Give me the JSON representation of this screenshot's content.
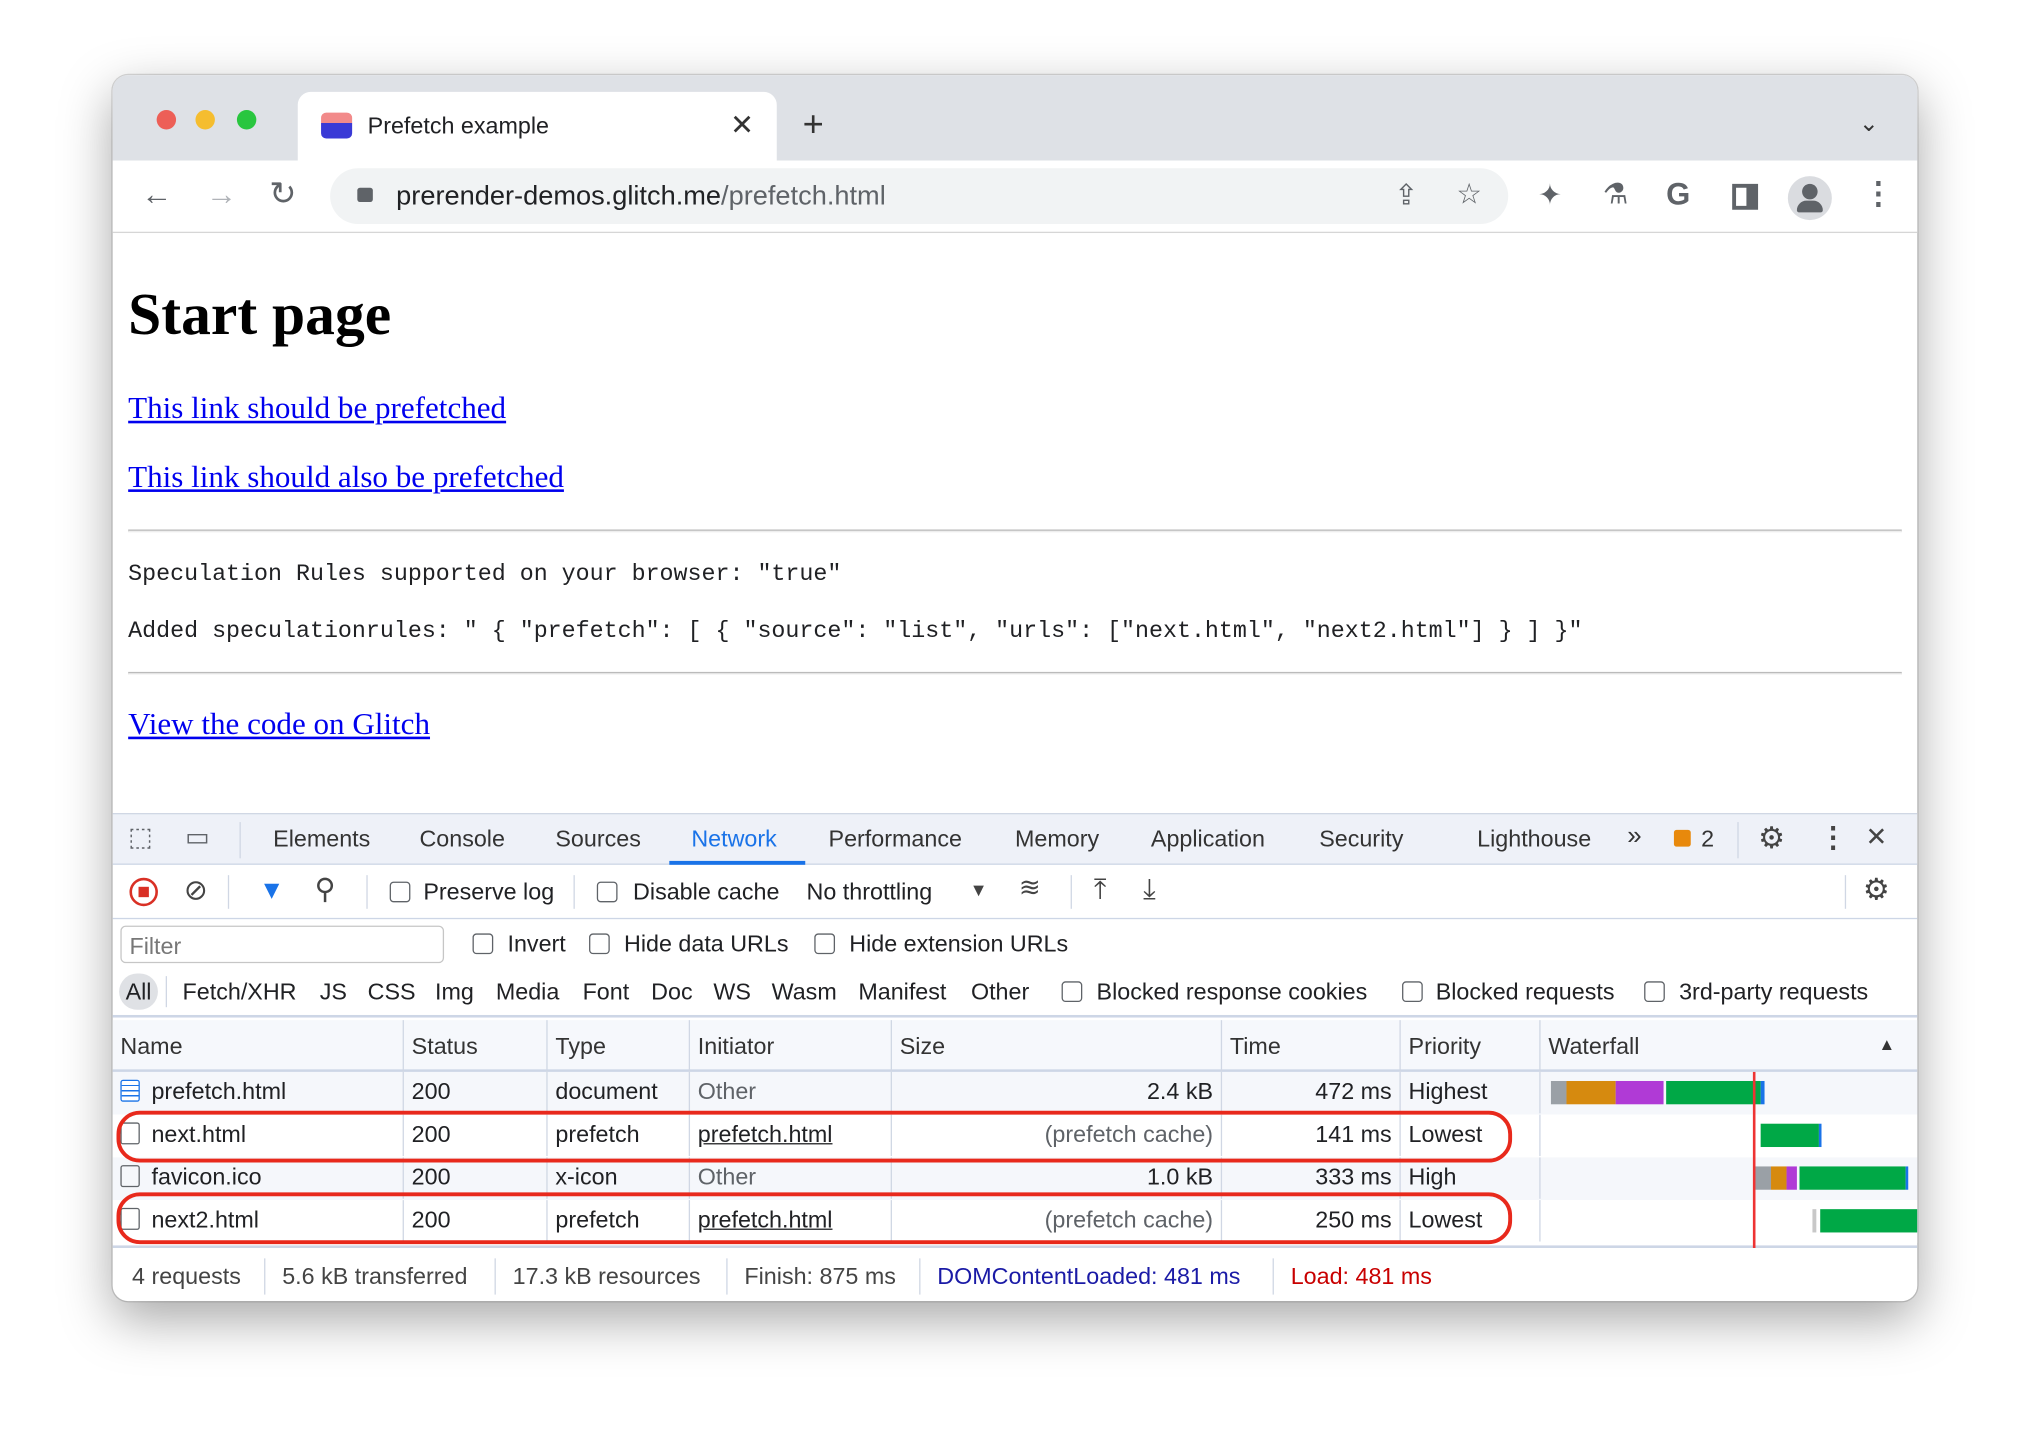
{
  "browser": {
    "tab_title": "Prefetch example",
    "url_host": "prerender-demos.glitch.me",
    "url_path": "/prefetch.html"
  },
  "page": {
    "heading": "Start page",
    "links": [
      "This link should be prefetched",
      "This link should also be prefetched"
    ],
    "speculation_line": "Speculation Rules supported on your browser: \"true\"",
    "rules_line": "Added speculationrules: \" { \"prefetch\": [ { \"source\": \"list\", \"urls\": [\"next.html\", \"next2.html\"] } ] }\"",
    "glitch_link": "View the code on Glitch"
  },
  "devtools": {
    "tabs": [
      "Elements",
      "Console",
      "Sources",
      "Network",
      "Performance",
      "Memory",
      "Application",
      "Security",
      "Lighthouse"
    ],
    "active_tab": "Network",
    "more": "»",
    "issues_count": "2",
    "toolbar": {
      "preserve_log": "Preserve log",
      "disable_cache": "Disable cache",
      "throttling": "No throttling"
    },
    "filter": {
      "placeholder": "Filter",
      "invert": "Invert",
      "hide_data": "Hide data URLs",
      "hide_ext": "Hide extension URLs"
    },
    "types": [
      "All",
      "Fetch/XHR",
      "JS",
      "CSS",
      "Img",
      "Media",
      "Font",
      "Doc",
      "WS",
      "Wasm",
      "Manifest",
      "Other"
    ],
    "type_checks": [
      "Blocked response cookies",
      "Blocked requests",
      "3rd-party requests"
    ],
    "columns": [
      "Name",
      "Status",
      "Type",
      "Initiator",
      "Size",
      "Time",
      "Priority",
      "Waterfall"
    ],
    "rows": [
      {
        "name": "prefetch.html",
        "status": "200",
        "type": "document",
        "initiator": "Other",
        "size": "2.4 kB",
        "time": "472 ms",
        "priority": "Highest"
      },
      {
        "name": "next.html",
        "status": "200",
        "type": "prefetch",
        "initiator": "prefetch.html",
        "size": "(prefetch cache)",
        "time": "141 ms",
        "priority": "Lowest"
      },
      {
        "name": "favicon.ico",
        "status": "200",
        "type": "x-icon",
        "initiator": "Other",
        "size": "1.0 kB",
        "time": "333 ms",
        "priority": "High"
      },
      {
        "name": "next2.html",
        "status": "200",
        "type": "prefetch",
        "initiator": "prefetch.html",
        "size": "(prefetch cache)",
        "time": "250 ms",
        "priority": "Lowest"
      }
    ],
    "summary": {
      "requests": "4 requests",
      "transferred": "5.6 kB transferred",
      "resources": "17.3 kB resources",
      "finish": "Finish: 875 ms",
      "dcl": "DOMContentLoaded: 481 ms",
      "load": "Load: 481 ms"
    },
    "colors": {
      "accent": "#1a73e8",
      "highlight_oval": "#e8291c",
      "dcl": "#1a1aa6",
      "load": "#c80000",
      "waterfall_green": "#00a846",
      "waterfall_orange": "#d68a0f",
      "waterfall_purple": "#b03ad6"
    }
  }
}
